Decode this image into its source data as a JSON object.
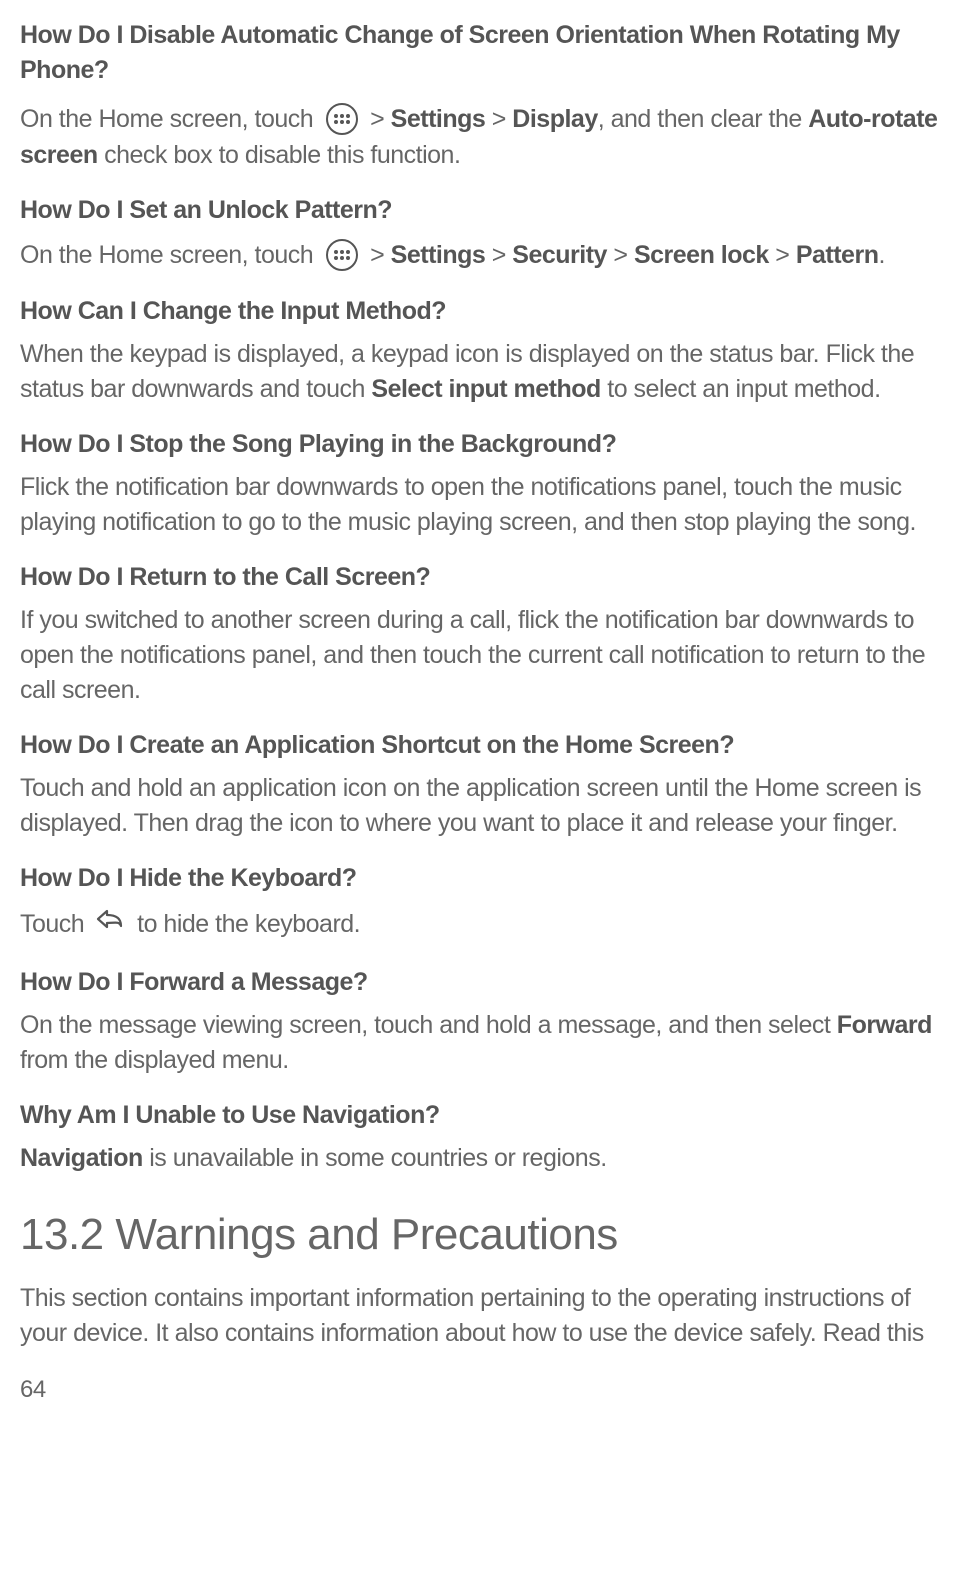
{
  "faq": [
    {
      "question": "How Do I Disable Automatic Change of Screen Orientation When Rotating My Phone?",
      "answer_pre": "On the Home screen, touch ",
      "nav": [
        " > ",
        "Settings",
        " > ",
        "Display"
      ],
      "answer_mid": ", and then clear the ",
      "bold2": "Auto-rotate screen",
      "answer_post": " check box to disable this function.",
      "icon": "apps"
    },
    {
      "question": "How Do I Set an Unlock Pattern?",
      "answer_pre": "On the Home screen, touch ",
      "nav": [
        " > ",
        "Settings",
        " > ",
        "Security",
        " > ",
        "Screen lock",
        " > ",
        "Pattern"
      ],
      "answer_post": ".",
      "icon": "apps"
    },
    {
      "question": "How Can I Change the Input Method?",
      "answer_pre": "When the keypad is displayed, a keypad icon is displayed on the status bar. Flick the status bar downwards and touch ",
      "bold1": "Select input method",
      "answer_post": " to select an input method."
    },
    {
      "question": "How Do I Stop the Song Playing in the Background?",
      "answer_plain": "Flick the notification bar downwards to open the notifications panel, touch the music playing notification to go to the music playing screen, and then stop playing the song."
    },
    {
      "question": "How Do I Return to the Call Screen?",
      "answer_plain": "If you switched to another screen during a call, flick the notification bar downwards to open the notifications panel, and then touch the current call notification to return to the call screen."
    },
    {
      "question": "How Do I Create an Application Shortcut on the Home Screen?",
      "answer_plain": "Touch and hold an application icon on the application screen until the Home screen is displayed. Then drag the icon to where you want to place it and release your finger."
    },
    {
      "question": "How Do I Hide the Keyboard?",
      "answer_pre": "Touch ",
      "answer_post": " to hide the keyboard.",
      "icon": "back"
    },
    {
      "question": "How Do I Forward a Message?",
      "answer_pre": "On the message viewing screen, touch and hold a message, and then select ",
      "bold1": "Forward",
      "answer_post": " from the displayed menu."
    },
    {
      "question": "Why Am I Unable to Use Navigation?",
      "bold1": "Navigation",
      "answer_post": " is unavailable in some countries or regions."
    }
  ],
  "section": {
    "heading": "13.2  Warnings and Precautions",
    "body": "This section contains important information pertaining to the operating instructions of your device. It also contains information about how to use the device safely. Read this"
  },
  "page_number": "64"
}
